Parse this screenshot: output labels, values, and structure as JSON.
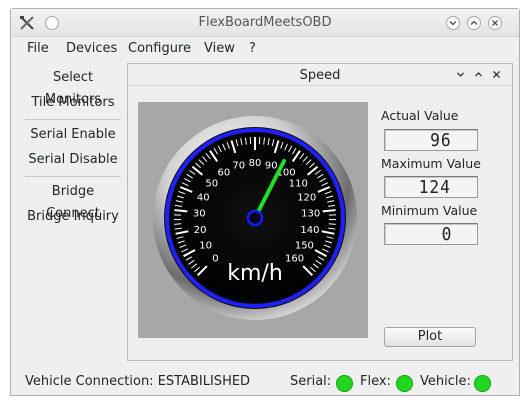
{
  "window": {
    "title": "FlexBoardMeetsOBD"
  },
  "menu": {
    "items": [
      "File",
      "Devices",
      "Configure",
      "View",
      "?"
    ]
  },
  "sidebar": {
    "buttons": [
      "Select Monitors",
      "Tile Monitors",
      "Serial Enable",
      "Serial Disable",
      "Bridge Connect",
      "Bridge Inquiry"
    ]
  },
  "subwindow": {
    "title": "Speed",
    "gauge": {
      "unit": "km/h",
      "min": 0,
      "max": 160,
      "major_ticks": [
        "0",
        "10",
        "20",
        "30",
        "40",
        "50",
        "60",
        "70",
        "80",
        "90",
        "100",
        "110",
        "120",
        "130",
        "140",
        "150",
        "160"
      ],
      "needle_value": 96,
      "ring_color": "#2020ff",
      "needle_color": "#22dd22"
    },
    "actual_label": "Actual Value",
    "actual_value": "96",
    "max_label": "Maximum Value",
    "max_value": "124",
    "min_label": "Minimum Value",
    "min_value": "0",
    "plot_button": "Plot"
  },
  "status": {
    "connection_text": "Vehicle Connection: ESTABILISHED",
    "serial_label": "Serial:",
    "flex_label": "Flex:",
    "vehicle_label": "Vehicle:",
    "led_color": "#22d622"
  }
}
